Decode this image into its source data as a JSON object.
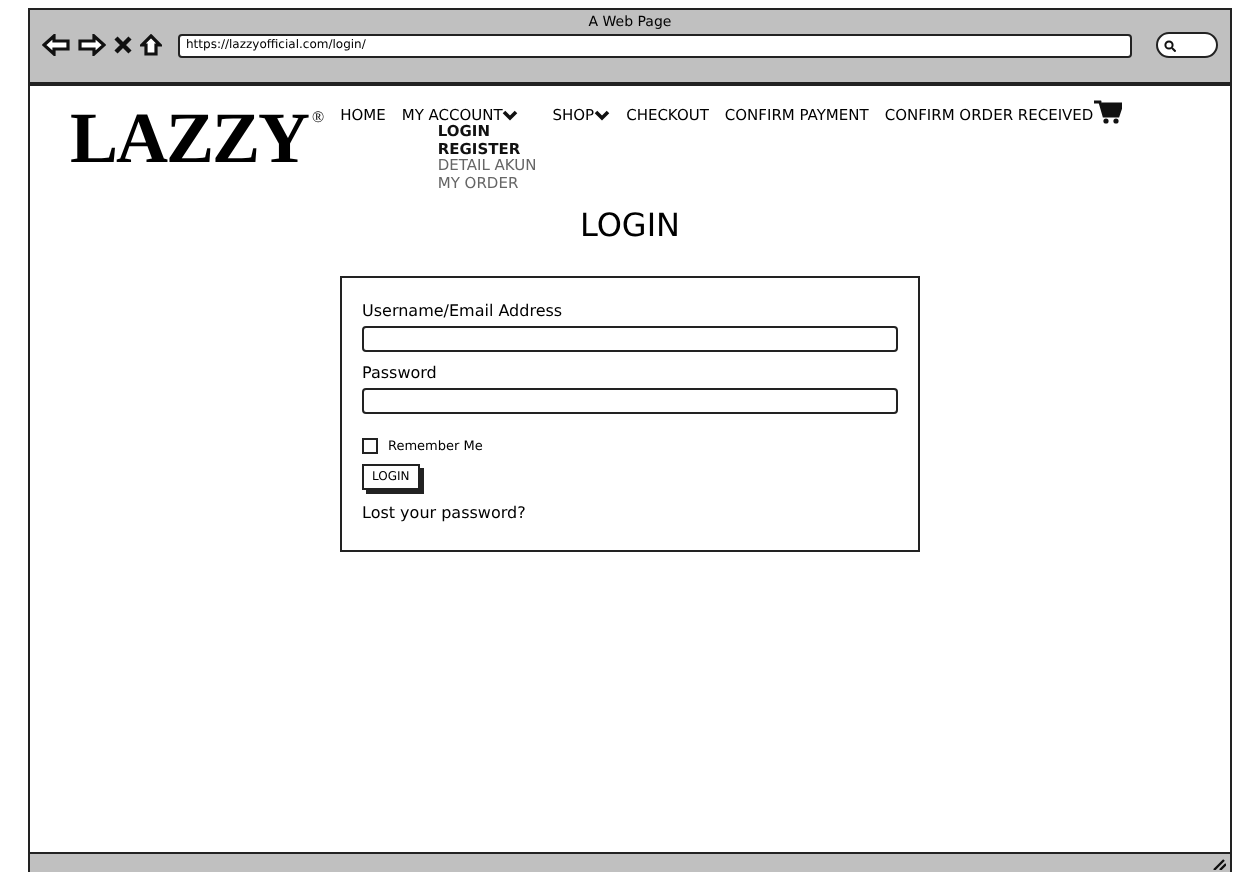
{
  "window": {
    "title": "A Web Page",
    "url": "https://lazzyofficial.com/login/"
  },
  "logo": {
    "text": "LAZZY",
    "mark": "®"
  },
  "nav": [
    {
      "label": "HOME",
      "dropdown": false
    },
    {
      "label": "MY ACCOUNT",
      "dropdown": true,
      "children": [
        {
          "label": "LOGIN",
          "selected": true
        },
        {
          "label": "REGISTER",
          "selected": true
        },
        {
          "label": "DETAIL AKUN",
          "selected": false
        },
        {
          "label": "MY ORDER",
          "selected": false
        }
      ]
    },
    {
      "label": "SHOP",
      "dropdown": true
    },
    {
      "label": "CHECKOUT",
      "dropdown": false
    },
    {
      "label": "CONFIRM PAYMENT",
      "dropdown": false
    },
    {
      "label": "CONFIRM ORDER RECEIVED",
      "dropdown": false
    }
  ],
  "page_title": "LOGIN",
  "form": {
    "fields": [
      {
        "label": "Username/Email Address"
      },
      {
        "label": "Password"
      }
    ],
    "remember": {
      "label": "Remember Me",
      "checked": false
    },
    "button": "LOGIN",
    "link": "Lost your password?"
  }
}
